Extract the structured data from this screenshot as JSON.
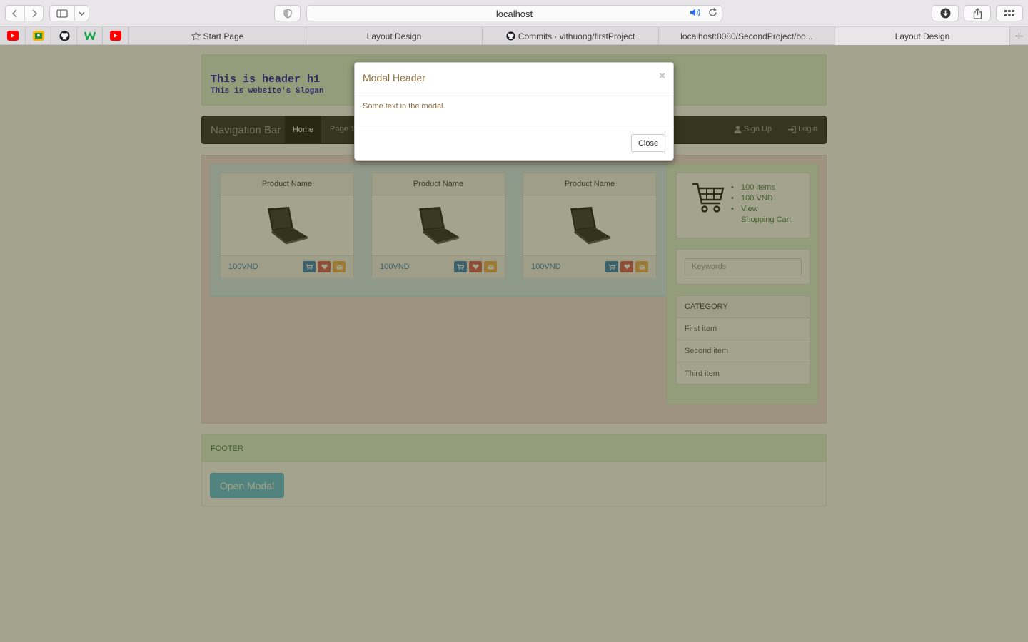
{
  "browser": {
    "url": "localhost",
    "tabs": [
      {
        "label": "Start Page",
        "active": false
      },
      {
        "label": "Layout Design",
        "active": false
      },
      {
        "label": "Commits · vithuong/firstProject",
        "active": false
      },
      {
        "label": "localhost:8080/SecondProject/bo...",
        "active": false
      },
      {
        "label": "Layout Design",
        "active": true
      }
    ],
    "favorites": [
      "youtube-icon",
      "google-classroom-icon",
      "github-icon",
      "w-icon",
      "youtube-icon"
    ]
  },
  "header": {
    "title": "This is header h1",
    "slogan": "This is website's Slogan"
  },
  "navbar": {
    "brand": "Navigation Bar",
    "home": "Home",
    "page1": "Page 1",
    "signup": "Sign Up",
    "login": "Login"
  },
  "products": [
    {
      "name": "Product Name",
      "price": "100VND"
    },
    {
      "name": "Product Name",
      "price": "100VND"
    },
    {
      "name": "Product Name",
      "price": "100VND"
    }
  ],
  "cart": {
    "items": [
      "100 items",
      "100 VND",
      "View",
      "Shopping Cart"
    ]
  },
  "search": {
    "placeholder": "Keywords"
  },
  "category": {
    "title": "CATEGORY",
    "items": [
      "First item",
      "Second item",
      "Third item"
    ]
  },
  "footer": {
    "text": "FOOTER",
    "open_modal": "Open Modal"
  },
  "modal": {
    "title": "Modal Header",
    "close_x": "×",
    "body": "Some text in the modal.",
    "close_button": "Close"
  },
  "colors": {
    "accent_blue": "#337ab7",
    "danger_red": "#d9534f",
    "warning_orange": "#f0ad4e",
    "info_cyan": "#5bc0de",
    "modal_text": "#8a6d3b"
  }
}
